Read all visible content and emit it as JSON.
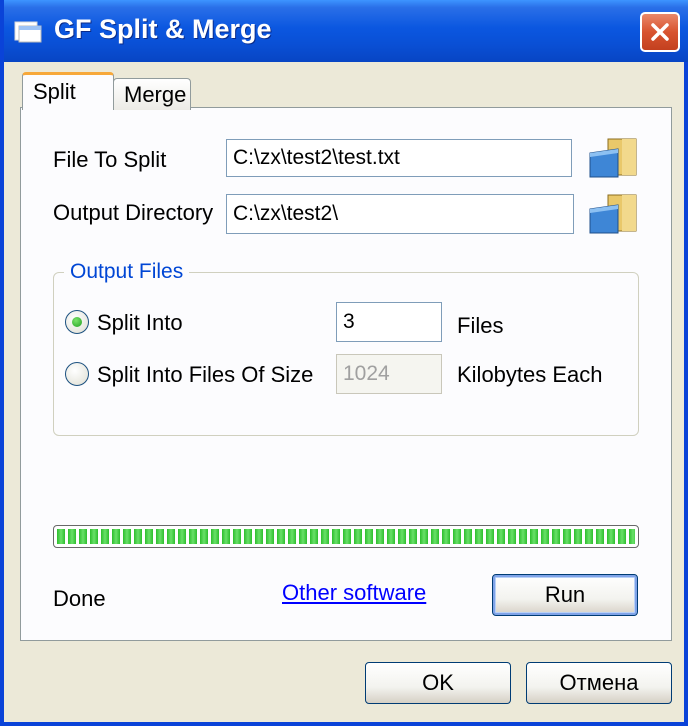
{
  "window": {
    "title": "GF Split & Merge",
    "title_icon": "app-folder-icon",
    "close_icon": "close-icon"
  },
  "tabs": [
    {
      "label": "Split",
      "active": true
    },
    {
      "label": "Merge",
      "active": false
    }
  ],
  "split": {
    "file_to_split": {
      "label": "File To Split",
      "value": "C:\\zx\\test2\\test.txt"
    },
    "output_directory": {
      "label": "Output Directory",
      "value": "C:\\zx\\test2\\"
    },
    "output_files": {
      "title": "Output Files",
      "split_into": {
        "label": "Split Into",
        "value": "3",
        "unit": "Files",
        "selected": true
      },
      "split_by_size": {
        "label": "Split Into Files Of Size",
        "value": "1024",
        "unit": "Kilobytes Each",
        "selected": false
      }
    },
    "progress": 1.0,
    "status": "Done",
    "other_software_link": "Other software",
    "run_label": "Run"
  },
  "footer": {
    "ok_label": "OK",
    "cancel_label": "Отмена"
  },
  "colors": {
    "title_bar": "#0A50D6",
    "group_title": "#0046D5",
    "progress": "#2DBE2D",
    "link": "#0000FF"
  }
}
